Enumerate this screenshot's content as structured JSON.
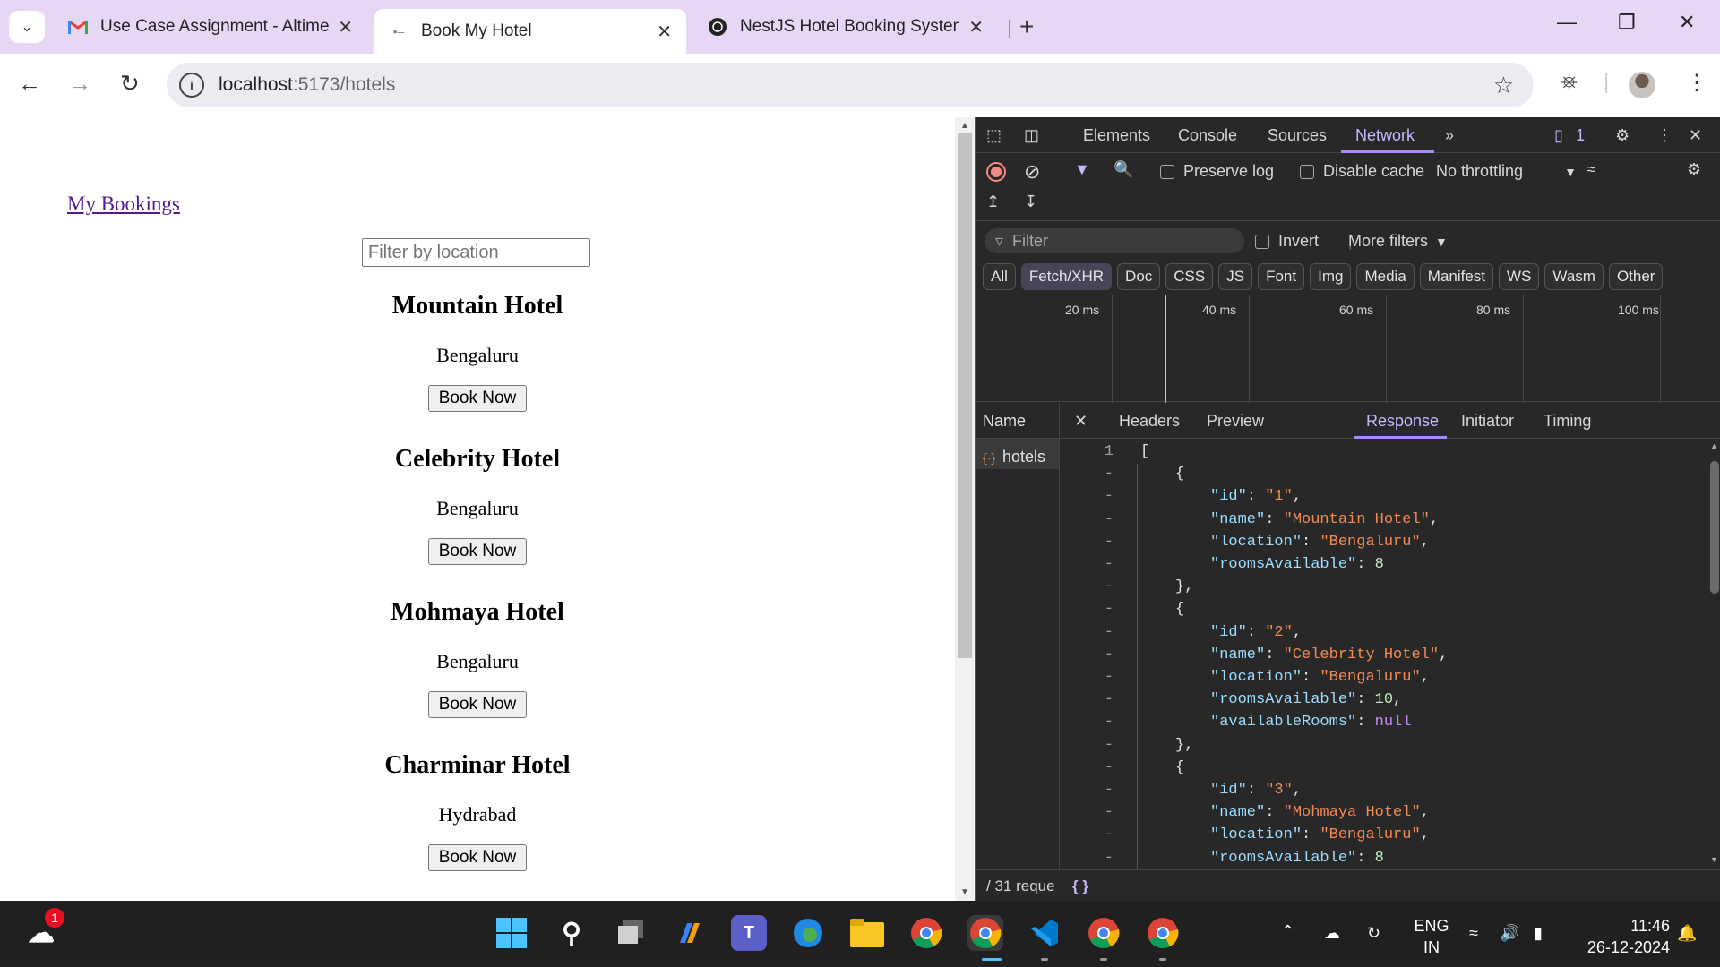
{
  "browser": {
    "tabs": [
      {
        "title": "Use Case Assignment - Altimetrik",
        "favicon": "gmail-icon"
      },
      {
        "title": "Book My Hotel",
        "favicon": "page-icon"
      },
      {
        "title": "NestJS Hotel Booking System",
        "favicon": "chatgpt-icon"
      }
    ],
    "url_host": "localhost",
    "url_path": ":5173/hotels"
  },
  "page": {
    "my_bookings_link": "My Bookings",
    "filter_placeholder": "Filter by location",
    "book_button_label": "Book Now",
    "hotels": [
      {
        "name": "Mountain Hotel",
        "location": "Bengaluru"
      },
      {
        "name": "Celebrity Hotel",
        "location": "Bengaluru"
      },
      {
        "name": "Mohmaya Hotel",
        "location": "Bengaluru"
      },
      {
        "name": "Charminar Hotel",
        "location": "Hydrabad"
      }
    ]
  },
  "devtools": {
    "main_tabs": [
      "Elements",
      "Console",
      "Sources",
      "Network"
    ],
    "active_main_tab": "Network",
    "issues_count": "1",
    "preserve_log": "Preserve log",
    "disable_cache": "Disable cache",
    "throttling": "No throttling",
    "filter_placeholder": "Filter",
    "invert": "Invert",
    "more_filters": "More filters",
    "type_filters": [
      "All",
      "Fetch/XHR",
      "Doc",
      "CSS",
      "JS",
      "Font",
      "Img",
      "Media",
      "Manifest",
      "WS",
      "Wasm",
      "Other"
    ],
    "active_type_filter": "Fetch/XHR",
    "timeline_labels": [
      "20 ms",
      "40 ms",
      "60 ms",
      "80 ms",
      "100 ms"
    ],
    "name_header": "Name",
    "request_name": "hotels",
    "detail_tabs": [
      "Headers",
      "Preview",
      "Response",
      "Initiator",
      "Timing"
    ],
    "active_detail_tab": "Response",
    "response_lines": [
      {
        "gutter": "1",
        "indent": 0,
        "text": "["
      },
      {
        "gutter": "-",
        "indent": 1,
        "text": "{"
      },
      {
        "gutter": "-",
        "indent": 2,
        "key": "\"id\"",
        "value": "\"1\"",
        "vtype": "s",
        "comma": true
      },
      {
        "gutter": "-",
        "indent": 2,
        "key": "\"name\"",
        "value": "\"Mountain Hotel\"",
        "vtype": "s",
        "comma": true
      },
      {
        "gutter": "-",
        "indent": 2,
        "key": "\"location\"",
        "value": "\"Bengaluru\"",
        "vtype": "s",
        "comma": true
      },
      {
        "gutter": "-",
        "indent": 2,
        "key": "\"roomsAvailable\"",
        "value": "8",
        "vtype": "n",
        "comma": false
      },
      {
        "gutter": "-",
        "indent": 1,
        "text": "},"
      },
      {
        "gutter": "-",
        "indent": 1,
        "text": "{"
      },
      {
        "gutter": "-",
        "indent": 2,
        "key": "\"id\"",
        "value": "\"2\"",
        "vtype": "s",
        "comma": true
      },
      {
        "gutter": "-",
        "indent": 2,
        "key": "\"name\"",
        "value": "\"Celebrity Hotel\"",
        "vtype": "s",
        "comma": true
      },
      {
        "gutter": "-",
        "indent": 2,
        "key": "\"location\"",
        "value": "\"Bengaluru\"",
        "vtype": "s",
        "comma": true
      },
      {
        "gutter": "-",
        "indent": 2,
        "key": "\"roomsAvailable\"",
        "value": "10",
        "vtype": "n",
        "comma": true
      },
      {
        "gutter": "-",
        "indent": 2,
        "key": "\"availableRooms\"",
        "value": "null",
        "vtype": "nl",
        "comma": false
      },
      {
        "gutter": "-",
        "indent": 1,
        "text": "},"
      },
      {
        "gutter": "-",
        "indent": 1,
        "text": "{"
      },
      {
        "gutter": "-",
        "indent": 2,
        "key": "\"id\"",
        "value": "\"3\"",
        "vtype": "s",
        "comma": true
      },
      {
        "gutter": "-",
        "indent": 2,
        "key": "\"name\"",
        "value": "\"Mohmaya Hotel\"",
        "vtype": "s",
        "comma": true
      },
      {
        "gutter": "-",
        "indent": 2,
        "key": "\"location\"",
        "value": "\"Bengaluru\"",
        "vtype": "s",
        "comma": true
      },
      {
        "gutter": "-",
        "indent": 2,
        "key": "\"roomsAvailable\"",
        "value": "8",
        "vtype": "n",
        "comma": false
      }
    ],
    "status_requests": "/ 31 reque",
    "status_format": "{ }"
  },
  "taskbar": {
    "weather_badge": "1",
    "lang_top": "ENG",
    "lang_bottom": "IN",
    "time": "11:46",
    "date": "26-12-2024"
  }
}
